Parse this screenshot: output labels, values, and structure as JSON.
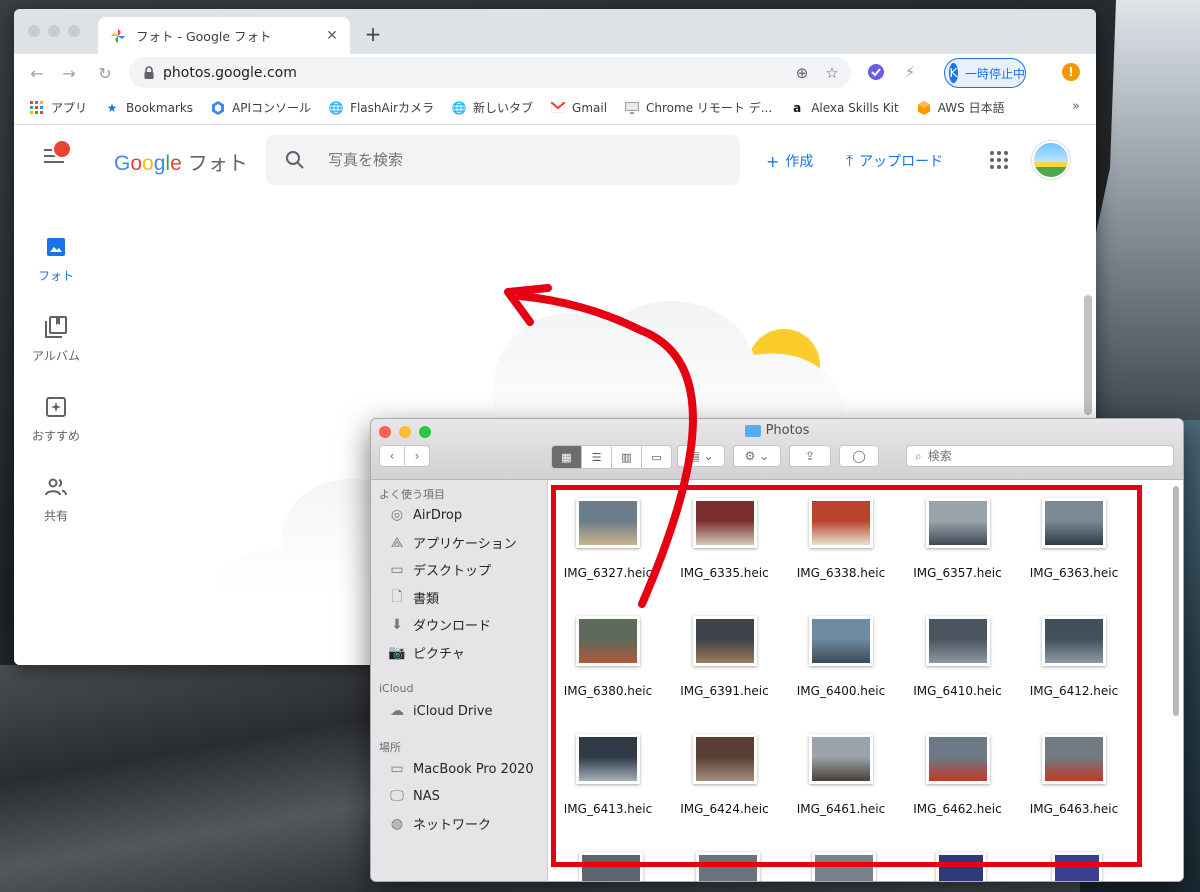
{
  "browser": {
    "tab_title": "フォト - Google フォト",
    "url": "photos.google.com",
    "profile_initial": "K",
    "profile_label": "一時停止中",
    "alert": "!",
    "bookmarks": [
      {
        "label": "アプリ",
        "icon": "apps-grid-icon"
      },
      {
        "label": "Bookmarks",
        "icon": "star-icon"
      },
      {
        "label": "APIコンソール",
        "icon": "hexagon-icon"
      },
      {
        "label": "FlashAirカメラ",
        "icon": "globe-icon"
      },
      {
        "label": "新しいタブ",
        "icon": "globe-icon"
      },
      {
        "label": "Gmail",
        "icon": "gmail-icon"
      },
      {
        "label": "Chrome リモート デ...",
        "icon": "remote-icon"
      },
      {
        "label": "Alexa Skills Kit",
        "icon": "amazon-icon"
      },
      {
        "label": "AWS 日本語",
        "icon": "aws-icon"
      }
    ],
    "bookmarks_more": "»"
  },
  "photos": {
    "logo": {
      "G": "G",
      "o1": "o",
      "o2": "o",
      "g": "g",
      "l": "l",
      "e": "e",
      "suffix": "フォト"
    },
    "search_placeholder": "写真を検索",
    "create_label": "作成",
    "upload_label": "アップロード",
    "nav": [
      {
        "label": "フォト",
        "active": true
      },
      {
        "label": "アルバム",
        "active": false
      },
      {
        "label": "おすすめ",
        "active": false
      },
      {
        "label": "共有",
        "active": false
      }
    ]
  },
  "finder": {
    "title": "Photos",
    "search_placeholder": "検索",
    "sidebar": {
      "favorites_header": "よく使う項目",
      "favorites": [
        "AirDrop",
        "アプリケーション",
        "デスクトップ",
        "書類",
        "ダウンロード",
        "ピクチャ"
      ],
      "icloud_header": "iCloud",
      "icloud": [
        "iCloud Drive"
      ],
      "locations_header": "場所",
      "locations": [
        "MacBook Pro 2020",
        "NAS",
        "ネットワーク"
      ]
    },
    "files": [
      "IMG_6327.heic",
      "IMG_6335.heic",
      "IMG_6338.heic",
      "IMG_6357.heic",
      "IMG_6363.heic",
      "IMG_6380.heic",
      "IMG_6391.heic",
      "IMG_6400.heic",
      "IMG_6410.heic",
      "IMG_6412.heic",
      "IMG_6413.heic",
      "IMG_6424.heic",
      "IMG_6461.heic",
      "IMG_6462.heic",
      "IMG_6463.heic"
    ]
  },
  "colors": {
    "chrome_accent": "#1a73e8",
    "annotation_red": "#e50012"
  }
}
